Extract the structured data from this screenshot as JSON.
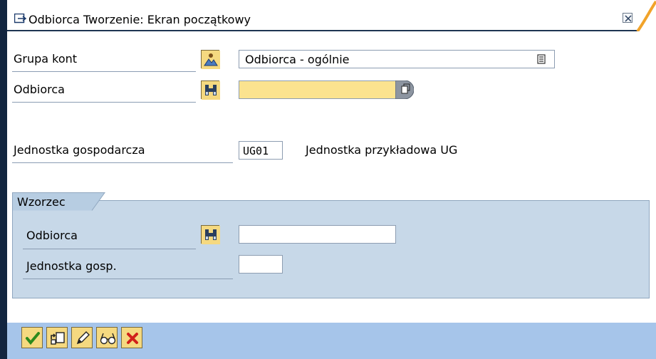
{
  "window": {
    "title": "Odbiorca Tworzenie: Ekran początkowy"
  },
  "form": {
    "account_group": {
      "label": "Grupa kont",
      "value": "Odbiorca - ogólnie"
    },
    "customer": {
      "label": "Odbiorca",
      "value": ""
    },
    "company_code": {
      "label": "Jednostka gospodarcza",
      "value": "UG01",
      "description": "Jednostka przykładowa UG"
    }
  },
  "reference": {
    "title": "Wzorzec",
    "customer": {
      "label": "Odbiorca",
      "value": ""
    },
    "company_code": {
      "label": "Jednostka gosp.",
      "value": ""
    }
  },
  "toolbar": {
    "buttons": [
      "check-icon",
      "save-icon",
      "edit-icon",
      "display-icon",
      "cancel-icon"
    ]
  }
}
